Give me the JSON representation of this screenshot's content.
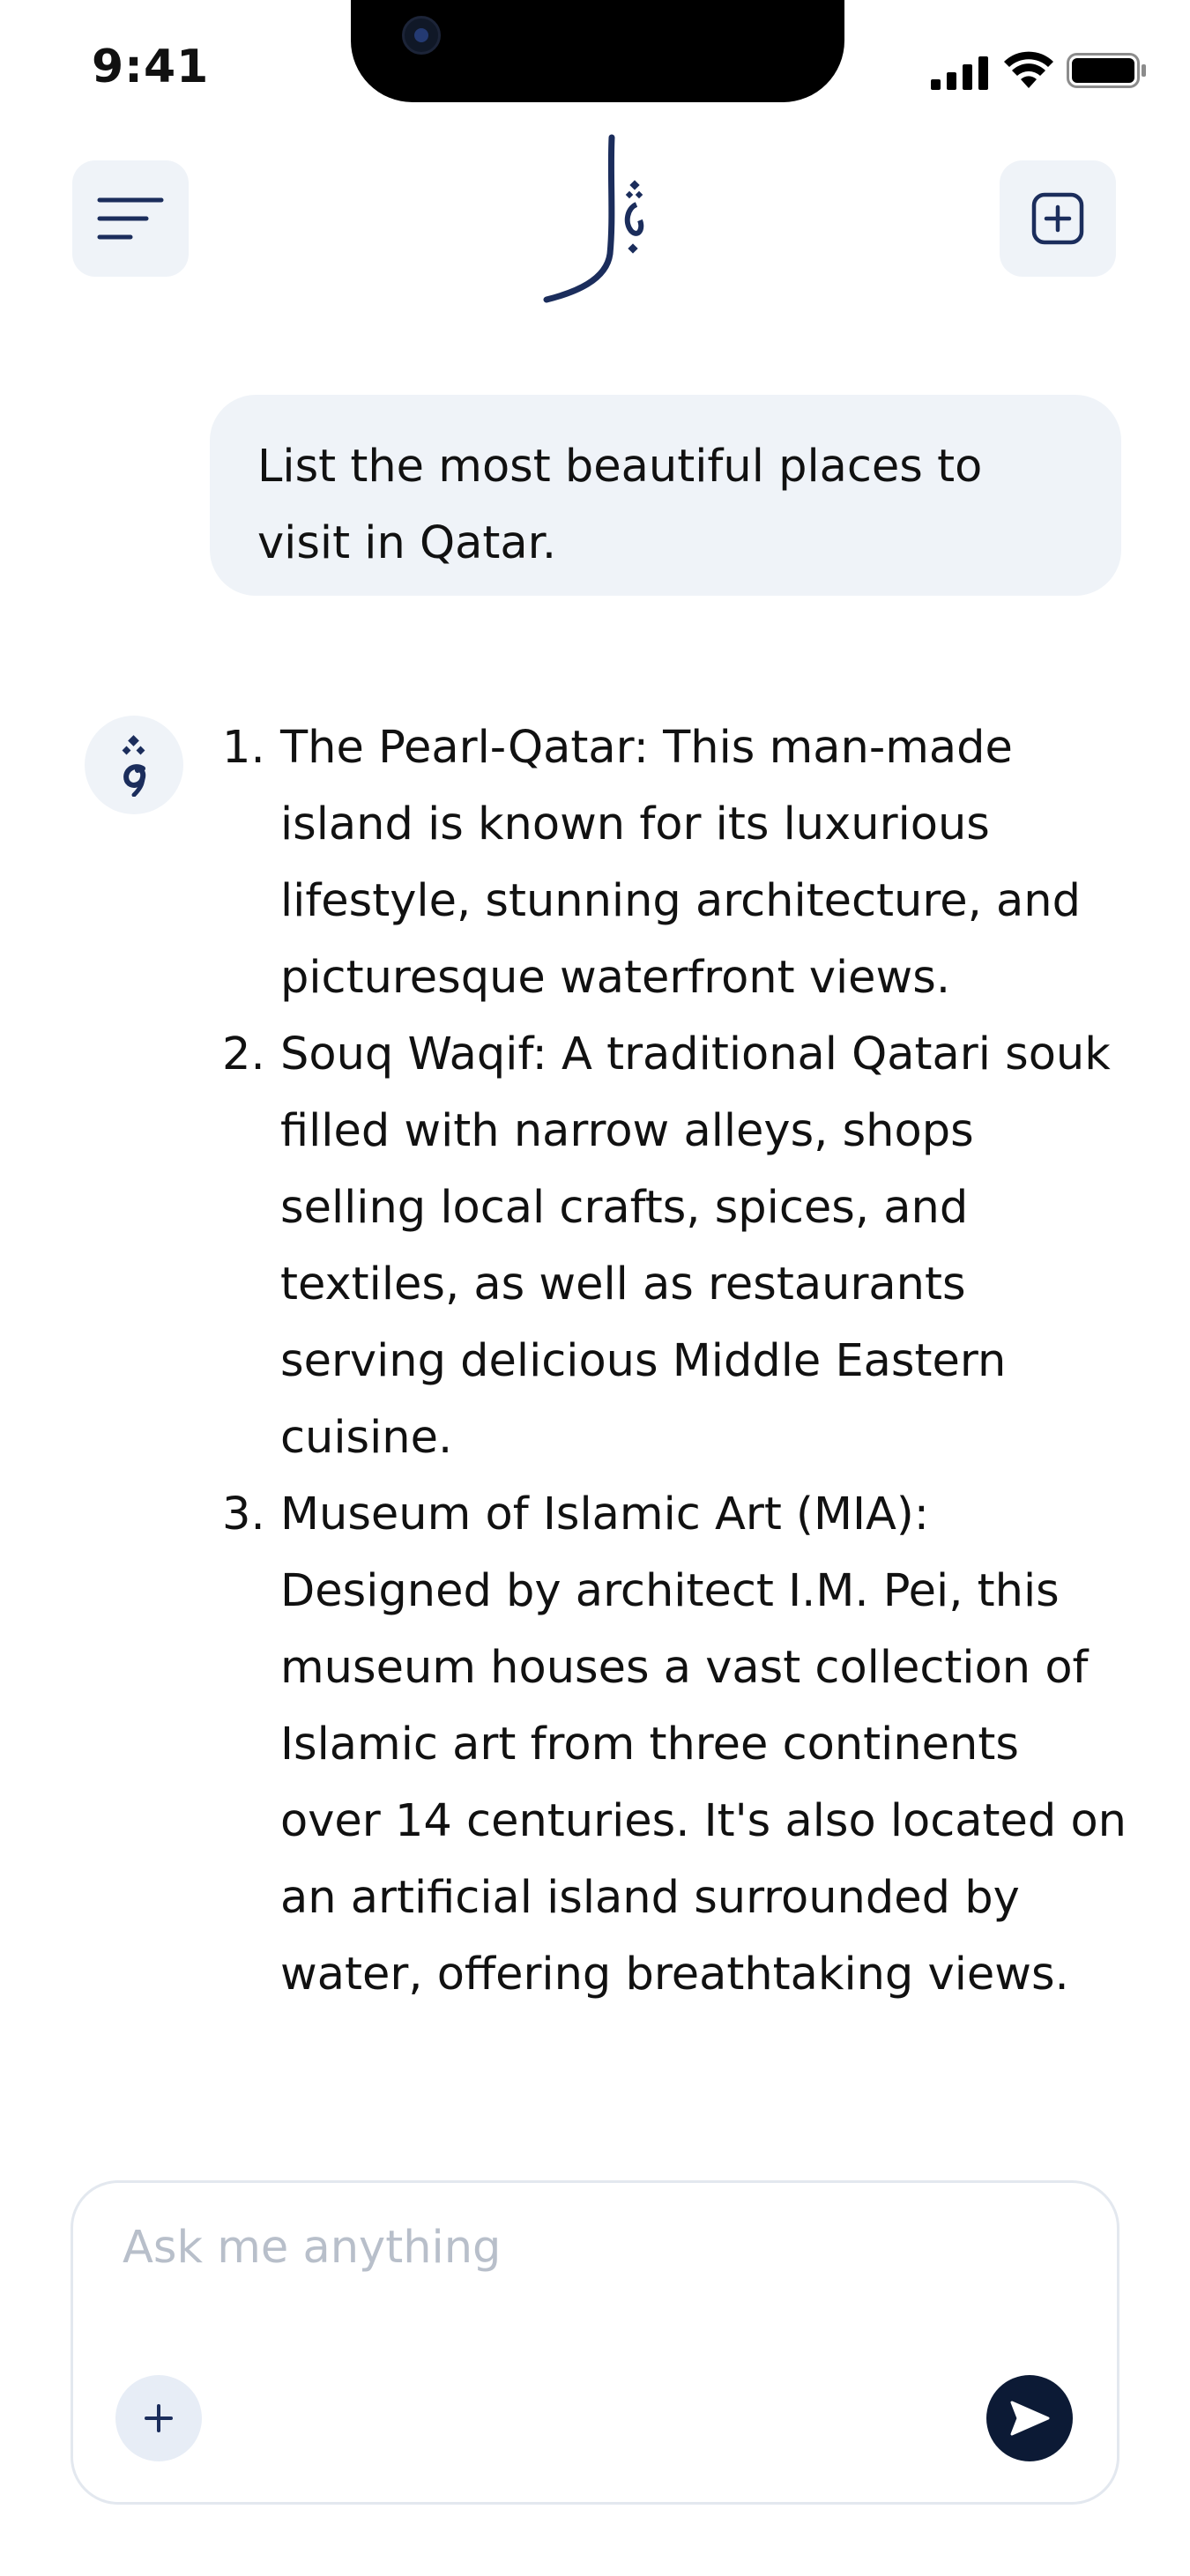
{
  "status_bar": {
    "time": "9:41"
  },
  "header": {
    "menu_icon": "menu-lines-icon",
    "logo": "arabic-calligraphy-logo",
    "new_chat_icon": "new-chat-plus-icon"
  },
  "conversation": {
    "user_message": "List the most beautiful places to visit in Qatar.",
    "assistant_items": [
      {
        "num": "1.",
        "text": "The Pearl-Qatar: This man-made island is known for its luxurious lifestyle, stunning architecture, and picturesque waterfront views."
      },
      {
        "num": "2.",
        "text": "Souq Waqif: A traditional Qatari souk filled with narrow alleys, shops selling local crafts, spices, and textiles, as well as restaurants serving delicious Middle Eastern cuisine."
      },
      {
        "num": "3.",
        "text": "Museum of Islamic Art (MIA): Designed by architect I.M. Pei, this museum houses a vast collection of Islamic art from three continents over 14 centuries. It's also located on an artificial island surrounded by water, offering breathtaking views."
      }
    ]
  },
  "composer": {
    "placeholder": "Ask me anything",
    "value": "",
    "attach_icon": "plus-icon",
    "send_icon": "send-arrow-icon"
  },
  "colors": {
    "brand_navy": "#1b2d5c",
    "surface": "#eff3f8",
    "send_button": "#0c1a35"
  }
}
